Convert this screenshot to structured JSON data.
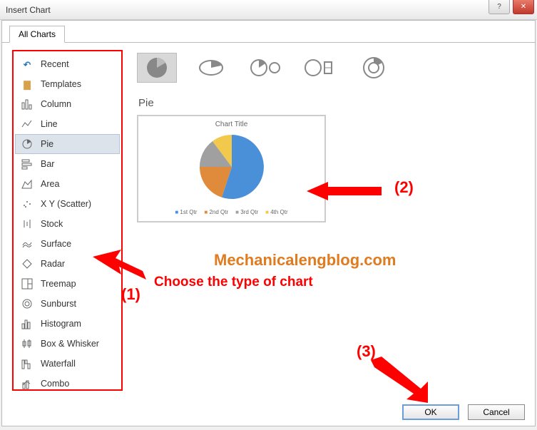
{
  "window": {
    "title": "Insert Chart"
  },
  "tabs": {
    "all_charts": "All Charts"
  },
  "sidebar": {
    "items": [
      {
        "label": "Recent"
      },
      {
        "label": "Templates"
      },
      {
        "label": "Column"
      },
      {
        "label": "Line"
      },
      {
        "label": "Pie"
      },
      {
        "label": "Bar"
      },
      {
        "label": "Area"
      },
      {
        "label": "X Y (Scatter)"
      },
      {
        "label": "Stock"
      },
      {
        "label": "Surface"
      },
      {
        "label": "Radar"
      },
      {
        "label": "Treemap"
      },
      {
        "label": "Sunburst"
      },
      {
        "label": "Histogram"
      },
      {
        "label": "Box & Whisker"
      },
      {
        "label": "Waterfall"
      },
      {
        "label": "Combo"
      }
    ],
    "selected_index": 4
  },
  "subtype_selected": 0,
  "chart_name": "Pie",
  "preview": {
    "title": "Chart Title",
    "legend": [
      "1st Qtr",
      "2nd Qtr",
      "3rd Qtr",
      "4th Qtr"
    ]
  },
  "buttons": {
    "ok": "OK",
    "cancel": "Cancel"
  },
  "annotations": {
    "one": "(1)",
    "two": "(2)",
    "three": "(3)",
    "choose": "Choose the type of chart",
    "watermark": "Mechanicalengblog.com"
  },
  "chart_data": {
    "type": "pie",
    "title": "Chart Title",
    "categories": [
      "1st Qtr",
      "2nd Qtr",
      "3rd Qtr",
      "4th Qtr"
    ],
    "values": [
      55,
      25,
      10,
      10
    ],
    "colors": [
      "#4a90d9",
      "#e08a3c",
      "#a0a0a0",
      "#f2c94c"
    ]
  }
}
